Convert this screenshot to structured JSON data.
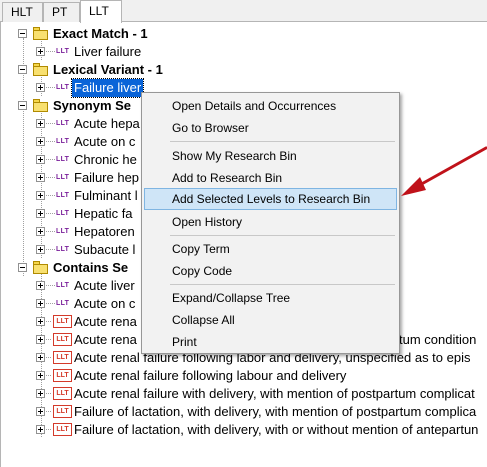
{
  "tabs": [
    {
      "label": "HLT"
    },
    {
      "label": "PT"
    },
    {
      "label": "LLT"
    }
  ],
  "tree": {
    "llt_icon_text": "LLT",
    "groups": {
      "exact": {
        "label": "Exact Match - 1"
      },
      "lexical": {
        "label": "Lexical Variant - 1"
      },
      "synonym": {
        "label": "Synonym Se"
      },
      "contains": {
        "label": "Contains Se"
      }
    },
    "exact_items": [
      "Liver failure"
    ],
    "lexical_items": [
      "Failure liver"
    ],
    "synonym_items": [
      "Acute hepa",
      "Acute on c",
      "Chronic he",
      "Failure hep",
      "Fulminant l",
      "Hepatic fa",
      "Hepatoren",
      "Subacute l"
    ],
    "contains_items": [
      "Acute liver",
      "Acute on c",
      "Acute rena",
      "Acute rena",
      "Acute renal failure following labor and delivery, unspecified as to epis",
      "Acute renal failure following labour and delivery",
      "Acute renal failure with delivery, with mention of postpartum complicat",
      "Failure of lactation, with delivery, with mention of postpartum complica",
      "Failure of lactation, with delivery, with or without mention of antepartun"
    ],
    "obscured_tail": "tum condition"
  },
  "context_menu": {
    "items": {
      "open_details": "Open Details and Occurrences",
      "go_browser": "Go to Browser",
      "show_bin": "Show My Research Bin",
      "add_bin": "Add to Research Bin",
      "add_selected": "Add Selected Levels to Research Bin",
      "open_history": "Open History",
      "copy_term": "Copy Term",
      "copy_code": "Copy Code",
      "expand_collapse": "Expand/Collapse Tree",
      "collapse_all": "Collapse All",
      "print": "Print"
    },
    "highlighted": "Add Selected Levels to Research Bin"
  },
  "colors": {
    "selection": "#0a64d8",
    "menu_highlight": "#cfe5f7",
    "llt_icon_purple": "#7a1f9a",
    "llt_icon_red": "#d43a2a",
    "arrow": "#c0121a"
  }
}
